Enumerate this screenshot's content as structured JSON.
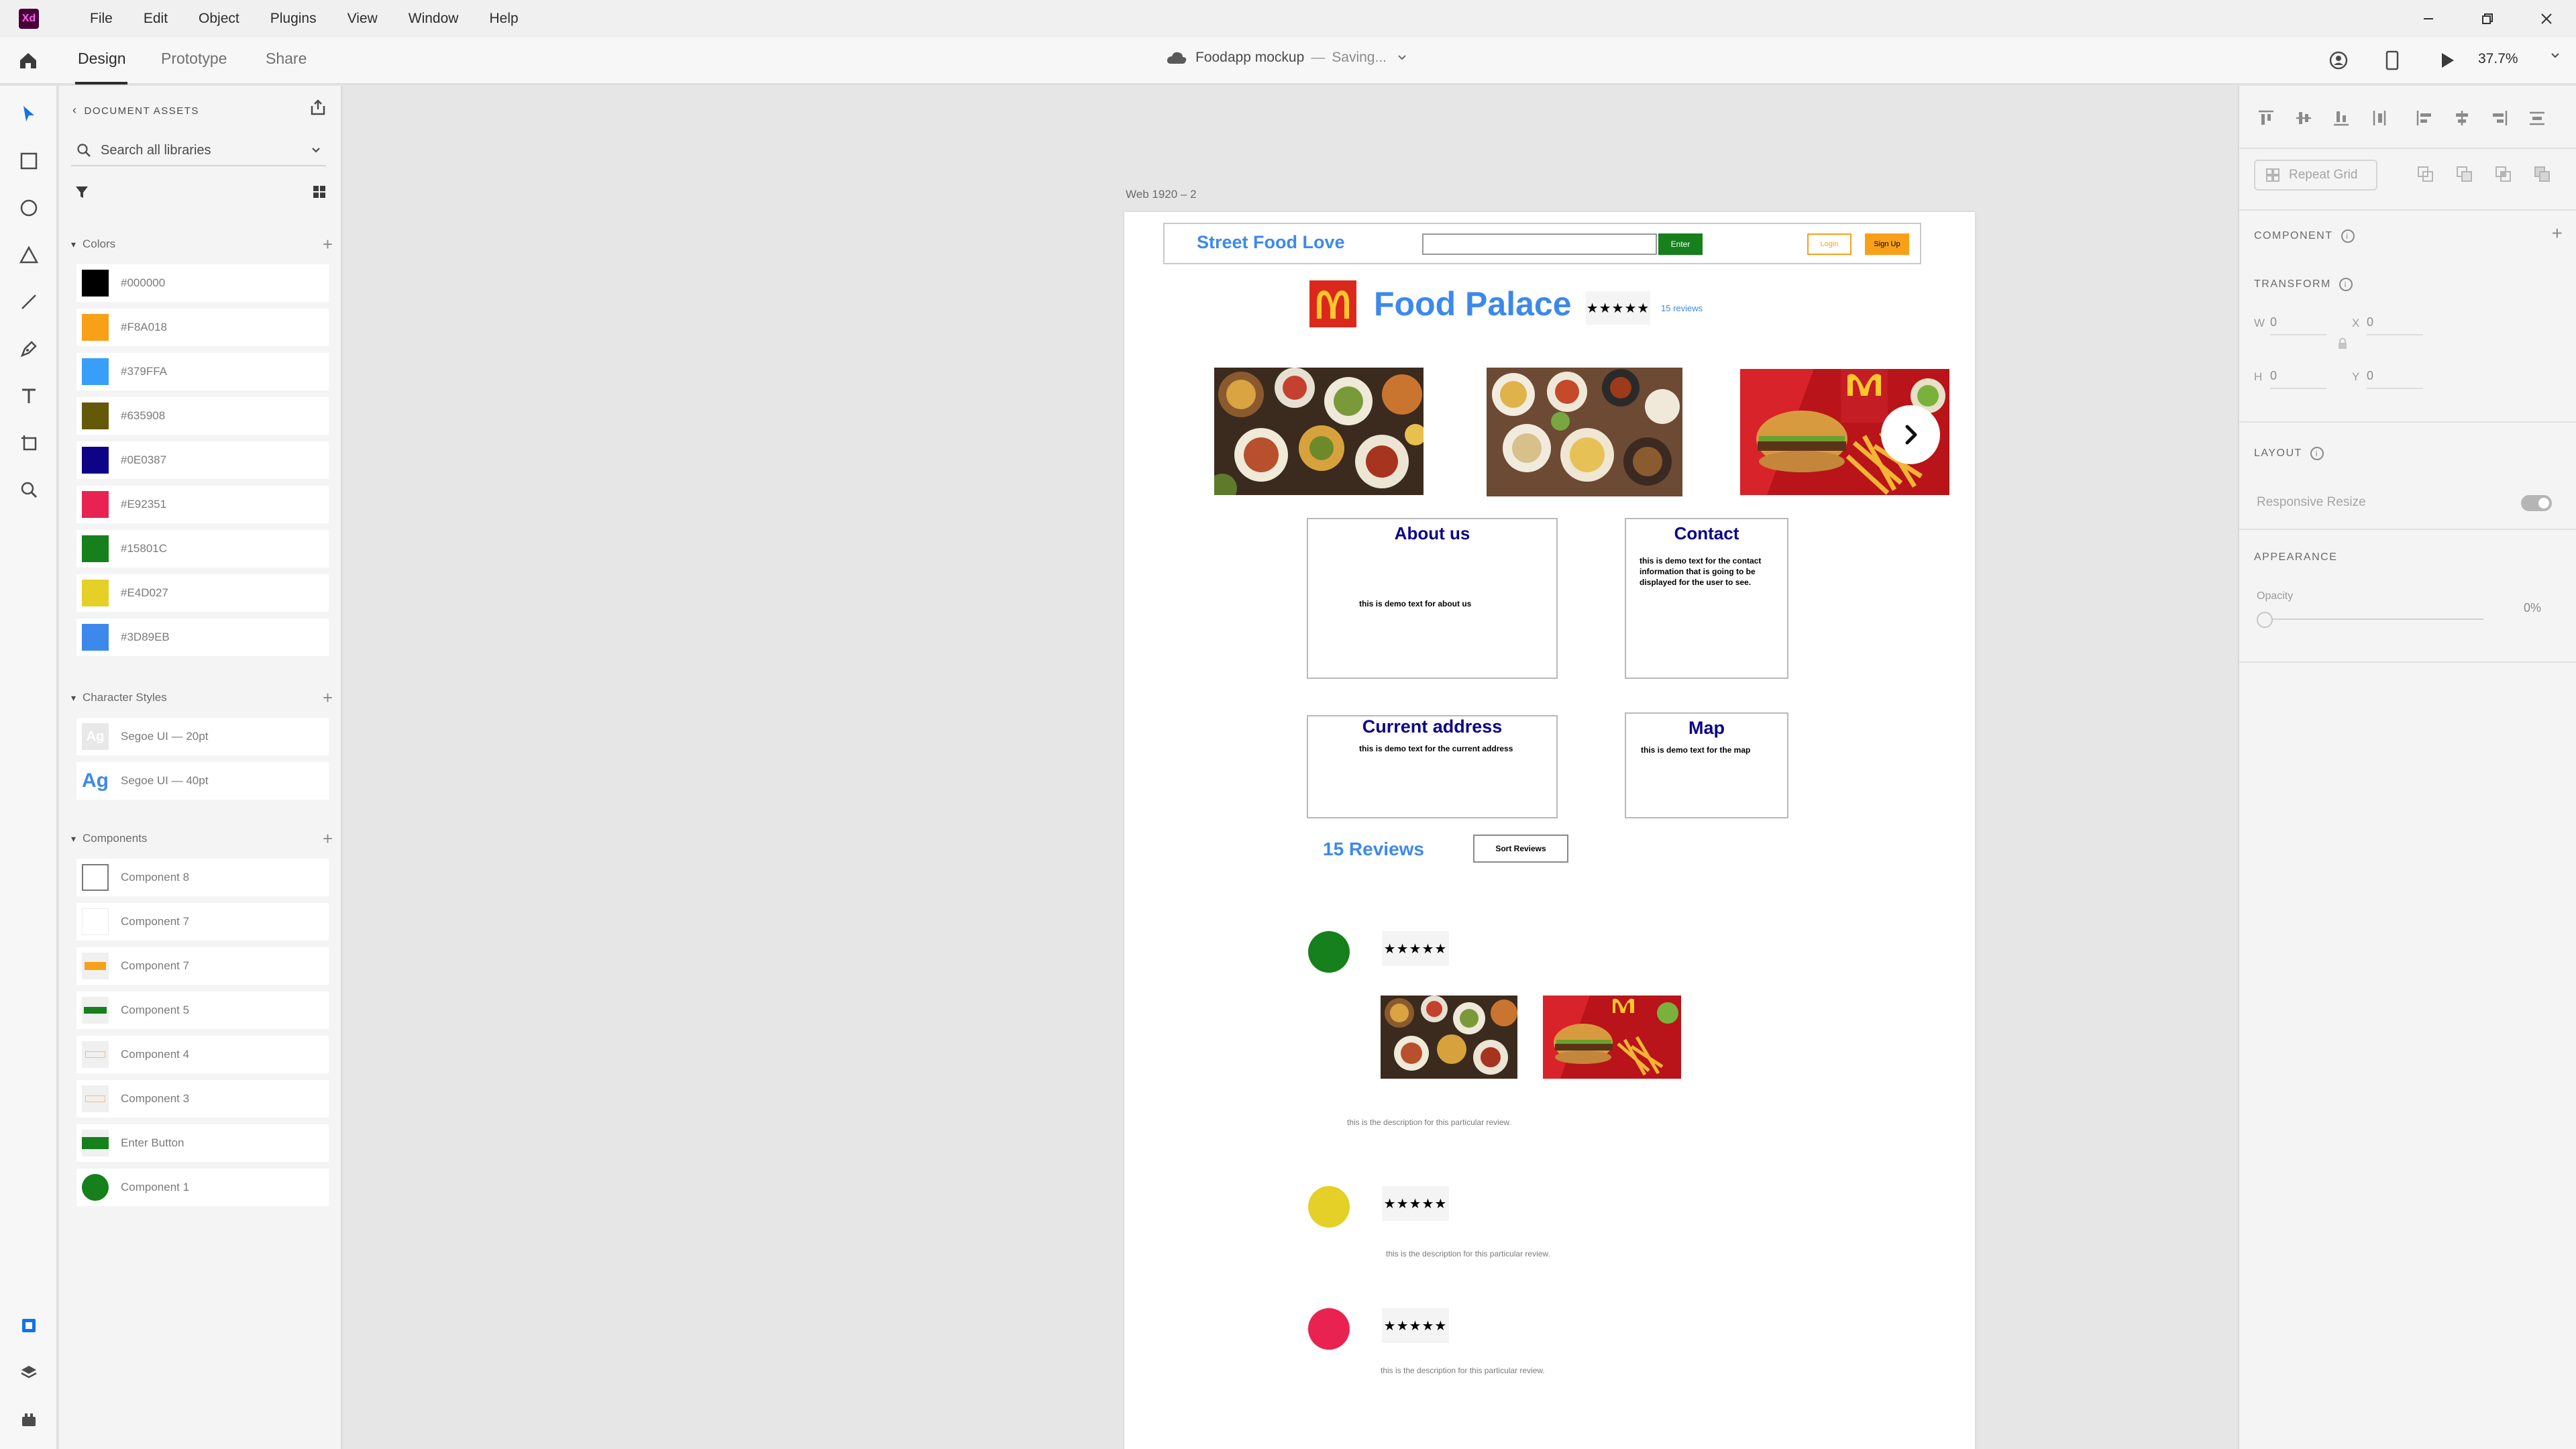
{
  "menubar": {
    "logo": "Xd",
    "items": [
      "File",
      "Edit",
      "Object",
      "Plugins",
      "View",
      "Window",
      "Help"
    ]
  },
  "toolbar": {
    "tabs": [
      "Design",
      "Prototype",
      "Share"
    ],
    "document_name": "Foodapp mockup",
    "separator": "—",
    "status": "Saving...",
    "zoom": "37.7%"
  },
  "assets": {
    "header": "DOCUMENT ASSETS",
    "search_placeholder": "Search all libraries",
    "colors_title": "Colors",
    "colors": [
      "#000000",
      "#F8A018",
      "#379FFA",
      "#635908",
      "#0E0387",
      "#E92351",
      "#15801C",
      "#E4D027",
      "#3D89EB"
    ],
    "char_styles_title": "Character Styles",
    "char_styles": [
      {
        "sample": "Ag",
        "label": "Segoe UI — 20pt"
      },
      {
        "sample": "Ag",
        "label": "Segoe UI — 40pt"
      }
    ],
    "components_title": "Components",
    "components": [
      "Component 8",
      "Component 7",
      "Component 7",
      "Component 5",
      "Component 4",
      "Component 3",
      "Enter Button",
      "Component 1"
    ]
  },
  "canvas": {
    "artboard_label": "Web 1920 – 2"
  },
  "site": {
    "brand": "Street Food Love",
    "enter_label": "Enter",
    "login_label": "Login",
    "signup_label": "Sign Up",
    "restaurant_name": "Food Palace",
    "stars": "★★★★★",
    "reviews_link": "15 reviews",
    "about_title": "About us",
    "about_text": "this is demo text for about us",
    "contact_title": "Contact",
    "contact_text": "this is demo text for the contact information that is going to be displayed for the user to see.",
    "address_title": "Current address",
    "address_text": "this is demo text for the current address",
    "map_title": "Map",
    "map_text": "this is demo text for the map",
    "reviews_count": "15 Reviews",
    "sort_label": "Sort Reviews",
    "reviews": [
      {
        "avatar_color": "#15801C",
        "stars": "★★★★★",
        "description": "this is the description for this particular review."
      },
      {
        "avatar_color": "#E4D027",
        "stars": "★★★★★",
        "description": "this is the description for this particular review."
      },
      {
        "avatar_color": "#E92351",
        "stars": "★★★★★",
        "description": "this is the description for this particular review."
      }
    ]
  },
  "properties": {
    "repeat_grid": "Repeat Grid",
    "component": "COMPONENT",
    "transform": "TRANSFORM",
    "w_label": "W",
    "w_value": "0",
    "x_label": "X",
    "x_value": "0",
    "h_label": "H",
    "h_value": "0",
    "y_label": "Y",
    "y_value": "0",
    "layout": "LAYOUT",
    "responsive_resize": "Responsive Resize",
    "appearance": "APPEARANCE",
    "opacity_label": "Opacity",
    "opacity_value": "0%"
  }
}
